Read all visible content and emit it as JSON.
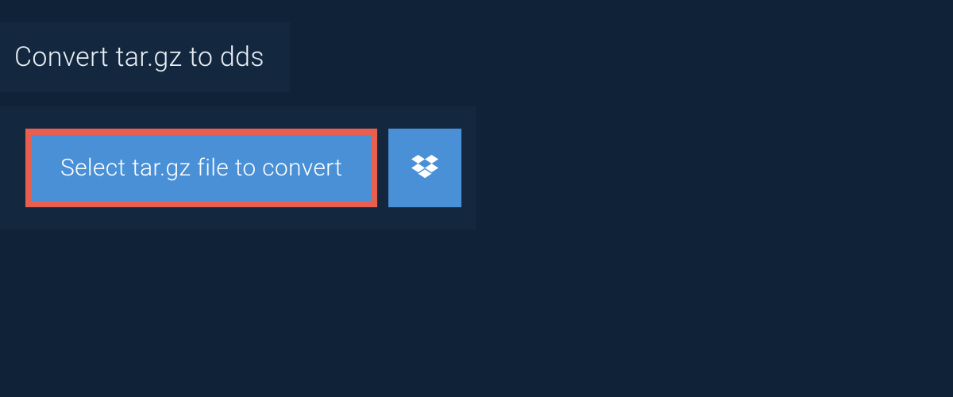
{
  "header": {
    "title": "Convert tar.gz to dds"
  },
  "actions": {
    "select_label": "Select tar.gz file to convert"
  },
  "colors": {
    "page_bg": "#0f2237",
    "panel_bg": "#13283f",
    "button_bg": "#4990d7",
    "highlight_border": "#e85f50",
    "text_light": "#e8eef4",
    "text_white": "#ffffff"
  }
}
